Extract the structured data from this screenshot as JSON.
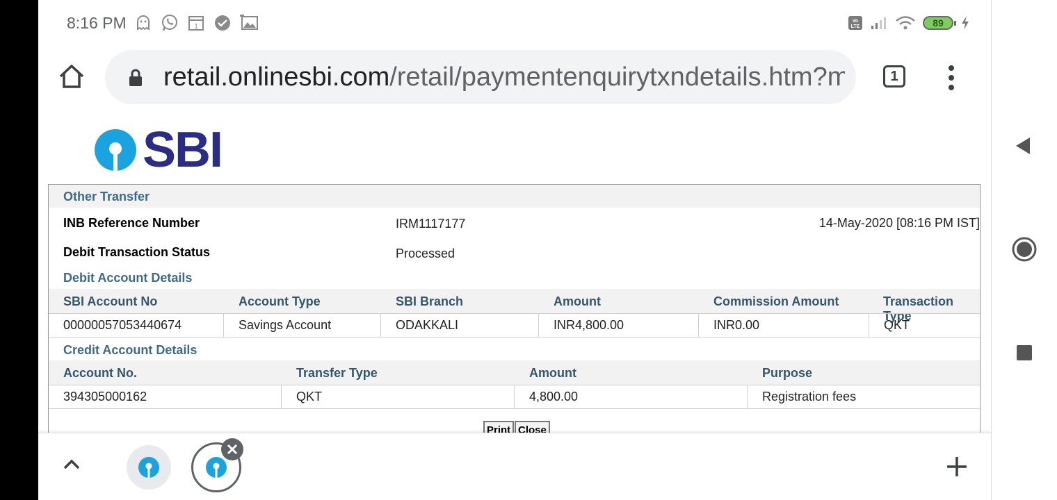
{
  "status_bar": {
    "time": "8:16 PM",
    "battery": "89",
    "left_icons": [
      "ghost-icon",
      "whatsapp-icon",
      "calendar-icon",
      "check-circle-icon",
      "gallery-icon"
    ],
    "right_icons": [
      "volte-icon",
      "signal-icon",
      "wifi-icon",
      "battery-icon",
      "charging-icon"
    ]
  },
  "browser": {
    "url_host": "retail.onlinesbi.com",
    "url_path": "/retail/paymentenquirytxndetails.htm?m",
    "tab_count": "1"
  },
  "page": {
    "logo_text": "SBI",
    "other_transfer": {
      "title": "Other Transfer",
      "ref_label": "INB Reference Number",
      "ref_value": "IRM1117177",
      "datetime": "14-May-2020 [08:16 PM IST]",
      "status_label": "Debit Transaction Status",
      "status_value": "Processed"
    },
    "debit": {
      "title": "Debit Account Details",
      "headers": [
        "SBI Account No",
        "Account Type",
        "SBI Branch",
        "Amount",
        "Commission Amount",
        "Transaction Type"
      ],
      "row": [
        "00000057053440674",
        "Savings Account",
        "ODAKKALI",
        "INR4,800.00",
        "INR0.00",
        "QKT"
      ]
    },
    "credit": {
      "title": "Credit Account Details",
      "headers": [
        "Account No.",
        "Transfer Type",
        "Amount",
        "Purpose"
      ],
      "row": [
        "394305000162",
        "QKT",
        "4,800.00",
        "Registration fees"
      ]
    },
    "buttons": {
      "print": "Print",
      "close": "Close"
    }
  },
  "colors": {
    "section_title": "#3e6a8a",
    "header_bg": "#f3f2f3",
    "sbi_blue": "#2b2d85",
    "sbi_cyan": "#1aa3df"
  }
}
